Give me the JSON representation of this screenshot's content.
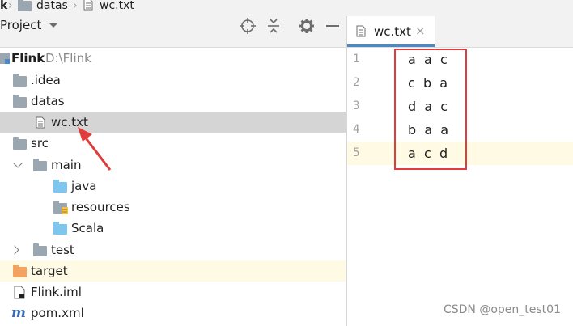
{
  "breadcrumb": {
    "root": "k",
    "folder": "datas",
    "file": "wc.txt"
  },
  "project": {
    "title": "Project",
    "tools": [
      "locate-icon",
      "collapse-icon",
      "settings-icon",
      "minimize-icon"
    ],
    "tree": [
      {
        "label": "Flink",
        "path": "D:\\Flink"
      },
      {
        "label": ".idea"
      },
      {
        "label": "datas"
      },
      {
        "label": "wc.txt"
      },
      {
        "label": "src"
      },
      {
        "label": "main"
      },
      {
        "label": "java"
      },
      {
        "label": "resources"
      },
      {
        "label": "Scala"
      },
      {
        "label": "test"
      },
      {
        "label": "target"
      },
      {
        "label": "Flink.iml"
      },
      {
        "label": "pom.xml"
      }
    ]
  },
  "editor": {
    "tab_label": "wc.txt",
    "close_glyph": "×",
    "line_numbers": [
      "1",
      "2",
      "3",
      "4",
      "5"
    ],
    "lines": [
      "a  a  c",
      "c  b  a",
      "d  a  c",
      "b  a  a",
      "a  c  d"
    ]
  },
  "watermark": "CSDN @open_test01",
  "colors": {
    "selection": "#d5d5d5",
    "current_line": "#fffae3",
    "annotation": "#e23b3b",
    "folder_blue": "#7fc6ee",
    "folder_gray": "#9aa7b0",
    "folder_orange": "#f3a35f"
  }
}
